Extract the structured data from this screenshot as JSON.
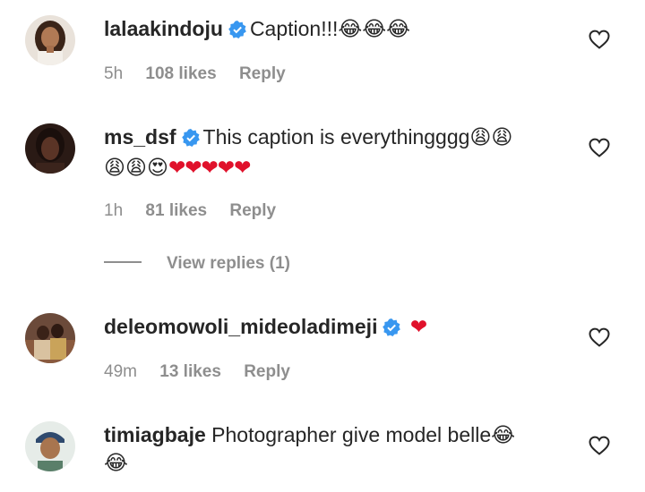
{
  "comments": [
    {
      "username": "lalaakindoju",
      "verified": true,
      "text_lines": [
        "Caption!!!😂😂😂"
      ],
      "time": "5h",
      "likes": "108 likes",
      "reply_label": "Reply",
      "avatar_icon": "woman-portrait-avatar"
    },
    {
      "username": "ms_dsf",
      "verified": true,
      "text_lines": [
        "This caption is everythingggg😩😩",
        "😩😩😍❤❤❤❤❤"
      ],
      "time": "1h",
      "likes": "81 likes",
      "reply_label": "Reply",
      "view_replies": "View replies (1)",
      "avatar_icon": "woman-dark-portrait-avatar"
    },
    {
      "username": "deleomowoli_mideoladimeji",
      "verified": true,
      "text_lines": [
        "❤"
      ],
      "time": "49m",
      "likes": "13 likes",
      "reply_label": "Reply",
      "avatar_icon": "couple-photo-avatar"
    },
    {
      "username": "timiagbaje",
      "verified": false,
      "text_lines": [
        "Photographer give model belle😂",
        "😂"
      ],
      "avatar_icon": "man-headwrap-avatar"
    }
  ],
  "colors": {
    "text": "#262626",
    "muted": "#8e8e8e",
    "verified_badge": "#3897f0",
    "heart": "#e0112b"
  },
  "icons": {
    "like": "heart-outline-icon",
    "verified": "verified-badge-icon"
  }
}
